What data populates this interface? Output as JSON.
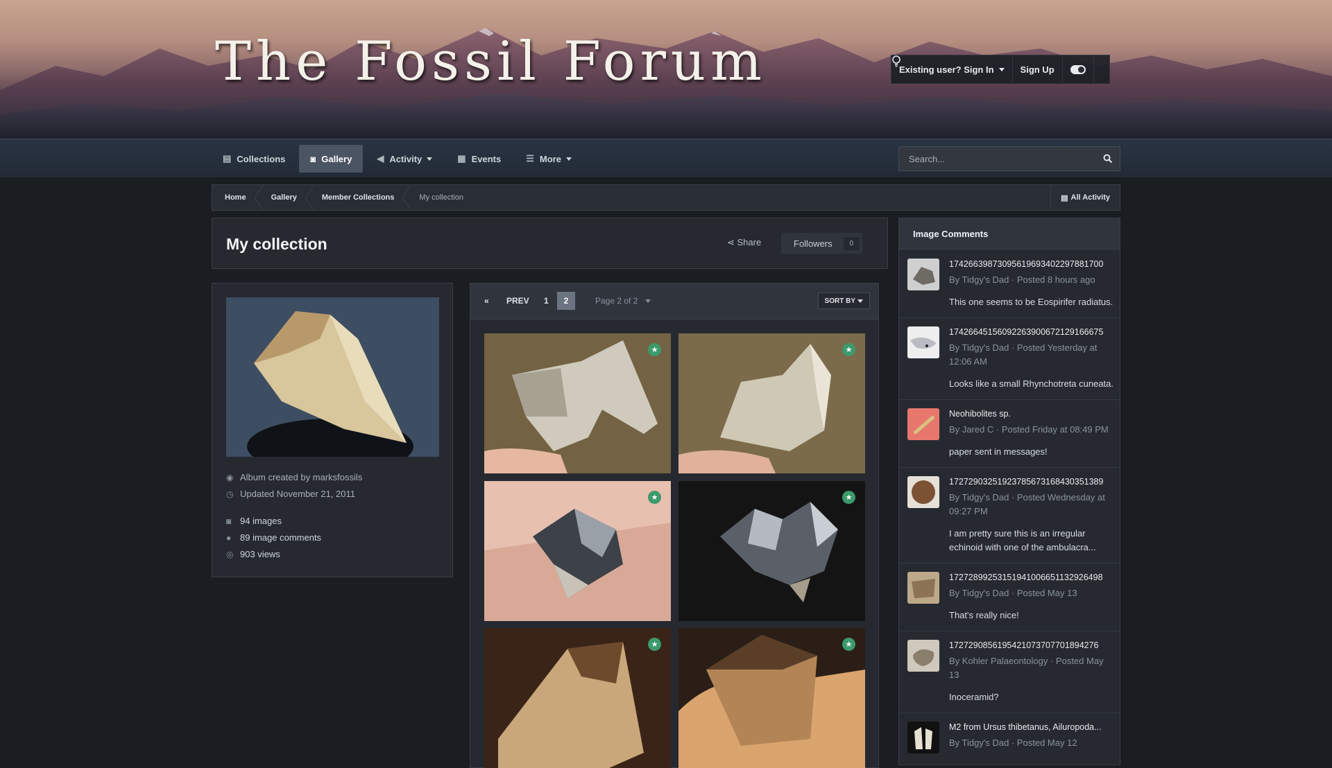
{
  "site": {
    "logo_text": "The Fossil Forum",
    "sign_in": "Existing user? Sign In",
    "sign_up": "Sign Up"
  },
  "nav": {
    "tabs": [
      {
        "label": "Collections",
        "icon": "document-icon"
      },
      {
        "label": "Gallery",
        "icon": "camera-icon",
        "active": true
      },
      {
        "label": "Activity",
        "icon": "megaphone-icon",
        "dropdown": true
      },
      {
        "label": "Events",
        "icon": "calendar-icon"
      },
      {
        "label": "More",
        "icon": "list-icon",
        "dropdown": true
      }
    ],
    "search_placeholder": "Search..."
  },
  "breadcrumb": {
    "items": [
      "Home",
      "Gallery",
      "Member Collections",
      "My collection"
    ],
    "all_activity": "All Activity"
  },
  "album": {
    "title": "My collection",
    "share": "Share",
    "followers_label": "Followers",
    "followers_count": "0",
    "created_by": "Album created by marksfossils",
    "updated": "Updated November 21, 2011",
    "images": "94 images",
    "comments": "89 image comments",
    "views": "903 views"
  },
  "pager": {
    "prev": "PREV",
    "page1": "1",
    "page2": "2",
    "page_of": "Page 2 of 2",
    "sort_by": "SORT BY"
  },
  "sidebar": {
    "title": "Image Comments",
    "comments": [
      {
        "title": "17426639873095619693402297881700",
        "by": "By Tidgy's Dad · Posted 8 hours ago",
        "body": "This one seems to be Eospirifer radiatus."
      },
      {
        "title": "17426645156092263900672129166675",
        "by": "By Tidgy's Dad · Posted Yesterday at 12:06 AM",
        "body": "Looks like a small Rhynchotreta cuneata."
      },
      {
        "title": "Neohibolites sp.",
        "by": "By Jared C · Posted Friday at 08:49 PM",
        "body": "paper sent in messages!"
      },
      {
        "title": "17272903251923785673168430351389",
        "by": "By Tidgy's Dad · Posted Wednesday at 09:27 PM",
        "body": "I am pretty sure this is an irregular echinoid with one of the ambulacra..."
      },
      {
        "title": "17272899253151941006651132926498",
        "by": "By Tidgy's Dad · Posted May 13",
        "body": "That's really nice!"
      },
      {
        "title": "17272908561954210737077018942 76",
        "by": "By Kohler Palaeontology · Posted May 13",
        "body": "Inoceramid?"
      },
      {
        "title": "M2 from Ursus thibetanus, Ailuropoda...",
        "by": "By Tidgy's Dad · Posted May 12",
        "body": ""
      }
    ]
  }
}
